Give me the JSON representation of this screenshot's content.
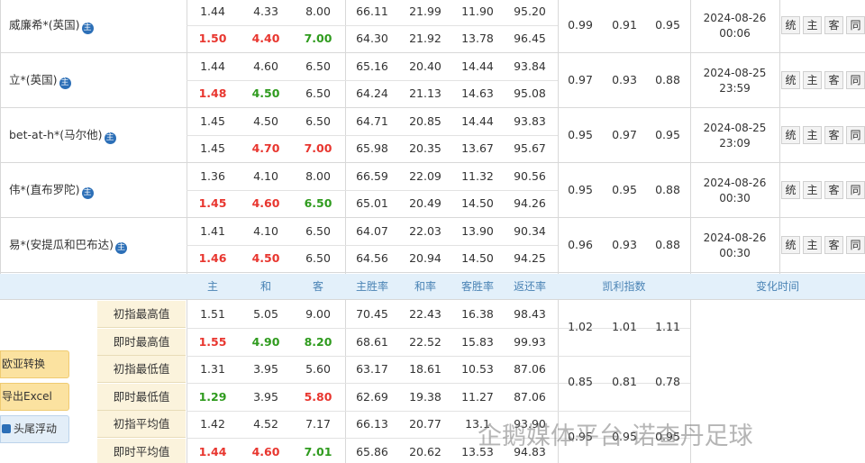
{
  "companies": [
    {
      "name": "威廉希*(英国)",
      "badge": "主",
      "initial": [
        "1.44",
        "4.33",
        "8.00",
        "66.11",
        "21.99",
        "11.90",
        "95.20"
      ],
      "live": [
        "1.50",
        "4.40",
        "7.00",
        "64.30",
        "21.92",
        "13.78",
        "96.45"
      ],
      "live_colors": [
        "red",
        "red",
        "green",
        "",
        "",
        "",
        ""
      ],
      "kelly": [
        "0.99",
        "0.91",
        "0.95"
      ],
      "date": "2024-08-26",
      "time": "00:06",
      "actions": [
        "统",
        "主",
        "客",
        "同"
      ]
    },
    {
      "name": "立*(英国)",
      "badge": "主",
      "initial": [
        "1.44",
        "4.60",
        "6.50",
        "65.16",
        "20.40",
        "14.44",
        "93.84"
      ],
      "live": [
        "1.48",
        "4.50",
        "6.50",
        "64.24",
        "21.13",
        "14.63",
        "95.08"
      ],
      "live_colors": [
        "red",
        "green",
        "",
        "",
        "",
        "",
        ""
      ],
      "kelly": [
        "0.97",
        "0.93",
        "0.88"
      ],
      "date": "2024-08-25",
      "time": "23:59",
      "actions": [
        "统",
        "主",
        "客",
        "同"
      ]
    },
    {
      "name": "bet-at-h*(马尔他)",
      "badge": "主",
      "initial": [
        "1.45",
        "4.50",
        "6.50",
        "64.71",
        "20.85",
        "14.44",
        "93.83"
      ],
      "live": [
        "1.45",
        "4.70",
        "7.00",
        "65.98",
        "20.35",
        "13.67",
        "95.67"
      ],
      "live_colors": [
        "",
        "red",
        "red",
        "",
        "",
        "",
        ""
      ],
      "kelly": [
        "0.95",
        "0.97",
        "0.95"
      ],
      "date": "2024-08-25",
      "time": "23:09",
      "actions": [
        "统",
        "主",
        "客",
        "同"
      ]
    },
    {
      "name": "伟*(直布罗陀)",
      "badge": "主",
      "initial": [
        "1.36",
        "4.10",
        "8.00",
        "66.59",
        "22.09",
        "11.32",
        "90.56"
      ],
      "live": [
        "1.45",
        "4.60",
        "6.50",
        "65.01",
        "20.49",
        "14.50",
        "94.26"
      ],
      "live_colors": [
        "red",
        "red",
        "green",
        "",
        "",
        "",
        ""
      ],
      "kelly": [
        "0.95",
        "0.95",
        "0.88"
      ],
      "date": "2024-08-26",
      "time": "00:30",
      "actions": [
        "统",
        "主",
        "客",
        "同"
      ]
    },
    {
      "name": "易*(安提瓜和巴布达)",
      "badge": "主",
      "initial": [
        "1.41",
        "4.10",
        "6.50",
        "64.07",
        "22.03",
        "13.90",
        "90.34"
      ],
      "live": [
        "1.46",
        "4.50",
        "6.50",
        "64.56",
        "20.94",
        "14.50",
        "94.25"
      ],
      "live_colors": [
        "red",
        "red",
        "",
        "",
        "",
        "",
        ""
      ],
      "kelly": [
        "0.96",
        "0.93",
        "0.88"
      ],
      "date": "2024-08-26",
      "time": "00:30",
      "actions": [
        "统",
        "主",
        "客",
        "同"
      ]
    }
  ],
  "summary_header": {
    "cols": [
      "主",
      "和",
      "客",
      "主胜率",
      "和率",
      "客胜率",
      "返还率"
    ],
    "kelly": "凯利指数",
    "change_time": "变化时间"
  },
  "summary_rows": [
    {
      "label": "初指最高值",
      "values": [
        "1.51",
        "5.05",
        "9.00",
        "70.45",
        "22.43",
        "16.38",
        "98.43"
      ],
      "colors": [
        "",
        "",
        "",
        "",
        "",
        "",
        ""
      ]
    },
    {
      "label": "即时最高值",
      "values": [
        "1.55",
        "4.90",
        "8.20",
        "68.61",
        "22.52",
        "15.83",
        "99.93"
      ],
      "colors": [
        "red",
        "green",
        "green",
        "",
        "",
        "",
        ""
      ]
    },
    {
      "label": "初指最低值",
      "values": [
        "1.31",
        "3.95",
        "5.60",
        "63.17",
        "18.61",
        "10.53",
        "87.06"
      ],
      "colors": [
        "",
        "",
        "",
        "",
        "",
        "",
        ""
      ]
    },
    {
      "label": "即时最低值",
      "values": [
        "1.29",
        "3.95",
        "5.80",
        "62.69",
        "19.38",
        "11.27",
        "87.06"
      ],
      "colors": [
        "green",
        "",
        "red",
        "",
        "",
        "",
        ""
      ]
    },
    {
      "label": "初指平均值",
      "values": [
        "1.42",
        "4.52",
        "7.17",
        "66.13",
        "20.77",
        "13.1",
        "93.90"
      ],
      "colors": [
        "",
        "",
        "",
        "",
        "",
        "",
        ""
      ]
    },
    {
      "label": "即时平均值",
      "values": [
        "1.44",
        "4.60",
        "7.01",
        "65.86",
        "20.62",
        "13.53",
        "94.83"
      ],
      "colors": [
        "red",
        "red",
        "green",
        "",
        "",
        "",
        ""
      ]
    }
  ],
  "summary_kelly": [
    [
      "1.02",
      "1.01",
      "1.11"
    ],
    [
      "0.85",
      "0.81",
      "0.78"
    ],
    [
      "0.95",
      "0.95",
      "0.95"
    ]
  ],
  "side_buttons": {
    "convert": "欧亚转换",
    "export": "导出Excel",
    "float_header": "头尾浮动"
  },
  "watermark": "企鹅媒体平台 诺查丹足球",
  "colors": {
    "red": "#e8362f",
    "green": "#2f9b1e",
    "header_bg": "#e3f0fa",
    "label_bg": "#fbf3dc",
    "badge": "#2c6fb7"
  }
}
